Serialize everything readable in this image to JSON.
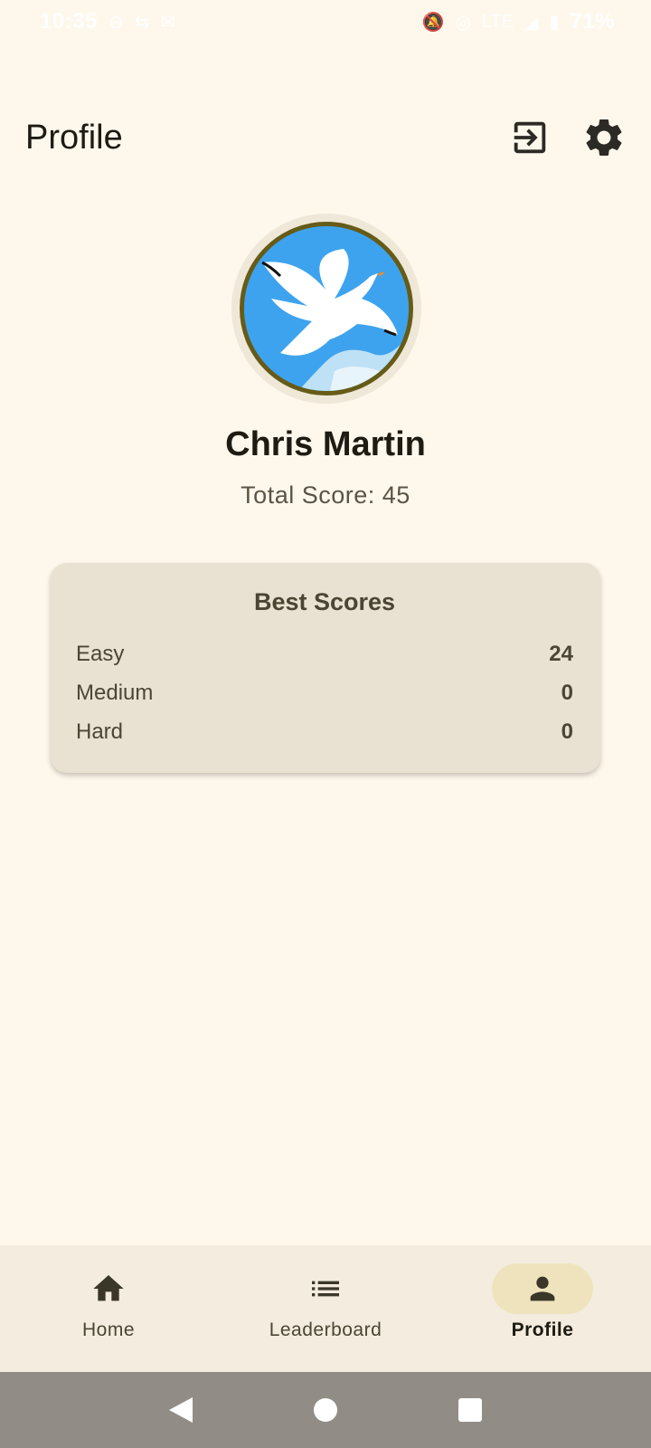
{
  "status_bar": {
    "time": "10:35",
    "battery": "71%",
    "network": "LTE"
  },
  "header": {
    "title": "Profile",
    "logout_icon": "logout-icon",
    "settings_icon": "gear-icon"
  },
  "profile": {
    "name": "Chris Martin",
    "total_score_label": "Total Score:",
    "total_score_value": "45",
    "avatar_icon": "seagull-avatar"
  },
  "best_scores": {
    "title": "Best Scores",
    "rows": [
      {
        "label": "Easy",
        "value": "24"
      },
      {
        "label": "Medium",
        "value": "0"
      },
      {
        "label": "Hard",
        "value": "0"
      }
    ]
  },
  "bottom_nav": {
    "items": [
      {
        "label": "Home",
        "icon": "home-icon",
        "active": false
      },
      {
        "label": "Leaderboard",
        "icon": "list-icon",
        "active": false
      },
      {
        "label": "Profile",
        "icon": "person-icon",
        "active": true
      }
    ]
  },
  "colors": {
    "background": "#FEF8EC",
    "card": "#E9E1D1",
    "avatar_border": "#665B17",
    "nav_active_pill": "#EFE3BE"
  }
}
